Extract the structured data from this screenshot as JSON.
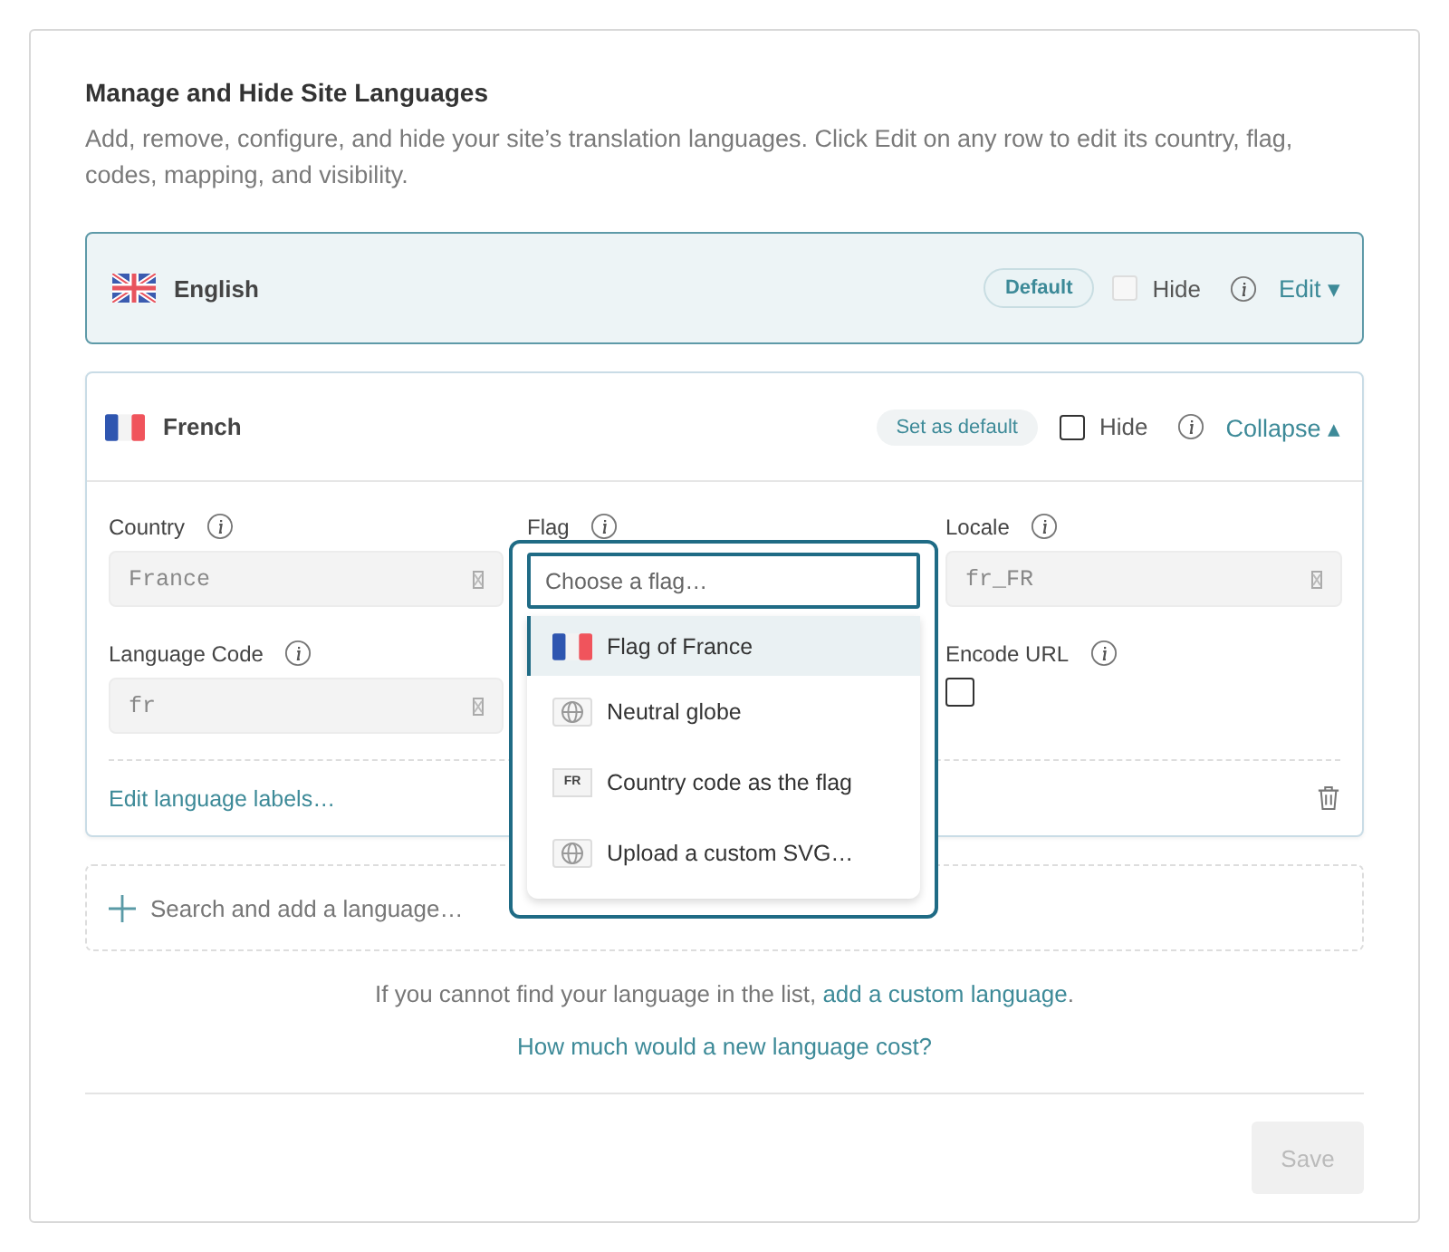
{
  "title": "Manage and Hide Site Languages",
  "description": "Add, remove, configure, and hide your site’s translation languages. Click Edit on any row to edit its country, flag, codes, mapping, and visibility.",
  "languages": [
    {
      "name": "English",
      "kind": "uk",
      "badge": {
        "kind": "default",
        "label": "Default"
      },
      "hide": {
        "label": "Hide",
        "checked": false,
        "disabled": true
      },
      "action": "Edit ▾",
      "expanded": false
    },
    {
      "name": "French",
      "kind": "fr",
      "badge": {
        "kind": "set_default",
        "label": "Set as default"
      },
      "hide": {
        "label": "Hide",
        "checked": false,
        "disabled": false
      },
      "action": "Collapse ▴",
      "expanded": true,
      "columns": [
        [
          {
            "kind": "text",
            "label": "Country",
            "value": "France"
          },
          {
            "kind": "text",
            "label": "Language Code",
            "value": "fr"
          }
        ],
        [
          {
            "kind": "select",
            "label": "Flag",
            "open": true,
            "placeholder": "Choose a flag…",
            "options": [
              {
                "kind": "flag_fr",
                "label": "Flag of France",
                "selected": true
              },
              {
                "kind": "globe",
                "label": "Neutral globe",
                "selected": false
              },
              {
                "kind": "code",
                "code": "FR",
                "label": "Country code as the flag",
                "selected": false
              },
              {
                "kind": "globe",
                "label": "Upload a custom SVG…",
                "selected": false
              }
            ]
          }
        ],
        [
          {
            "kind": "text",
            "label": "Locale",
            "value": "fr_FR"
          },
          {
            "kind": "checkbox",
            "label": "Encode URL",
            "checked": false
          }
        ]
      ],
      "labels_link": "Edit language labels…"
    }
  ],
  "add_placeholder": "Search and add a language…",
  "custom_note": "If you cannot find your language in the list,",
  "custom_link": "add a custom language",
  "custom_end": ".",
  "cost_link": "How much would a new language cost?",
  "save": {
    "label": "Save",
    "disabled": true
  }
}
